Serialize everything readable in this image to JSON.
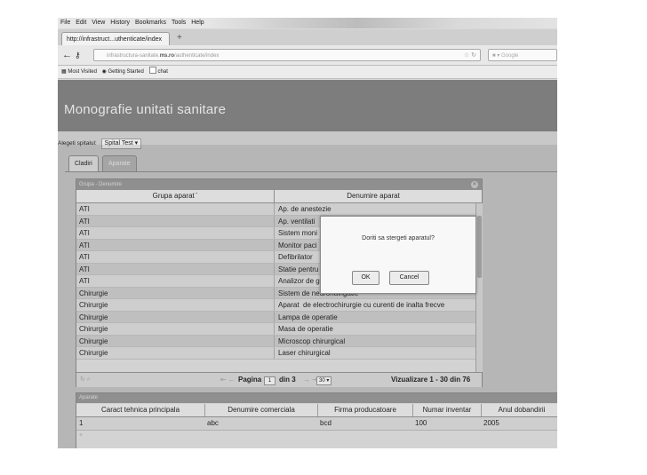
{
  "browser": {
    "menu": [
      "File",
      "Edit",
      "View",
      "History",
      "Bookmarks",
      "Tools",
      "Help"
    ],
    "tab_title": "http://infrastruct...uthenticate/index",
    "new_tab": "+",
    "url_prefix": "infrastructura-sanitate.",
    "url_domain": "ms.ro",
    "url_suffix": "/authenticate/index",
    "search_placeholder": "Google",
    "bookmarks": [
      "Most Visited",
      "Getting Started",
      "chat"
    ]
  },
  "app": {
    "title": "Monografie unitati sanitare",
    "hospital_label": "Alegeti spitalul:",
    "hospital_value": "Spital Test",
    "tabs": [
      "Cladiri",
      "Aparate"
    ]
  },
  "grid": {
    "caption": "Grupa - Denumire",
    "headers": [
      "Grupa aparat",
      "Denumire aparat"
    ],
    "rows": [
      {
        "grupa": "ATI",
        "denumire": "Ap. de anestezie"
      },
      {
        "grupa": "ATI",
        "denumire": "Ap. ventilati"
      },
      {
        "grupa": "ATI",
        "denumire": "Sistem moni"
      },
      {
        "grupa": "ATI",
        "denumire": "Monitor paci"
      },
      {
        "grupa": "ATI",
        "denumire": "Defibrilator"
      },
      {
        "grupa": "ATI",
        "denumire": "Statie pentru                                    dicamen"
      },
      {
        "grupa": "ATI",
        "denumire": "Analizor de g"
      },
      {
        "grupa": "Chirurgie",
        "denumire": "Sistem de neuronavigatie"
      },
      {
        "grupa": "Chirurgie",
        "denumire": "Aparat  de electrochirurgie cu curenti de inalta frecve"
      },
      {
        "grupa": "Chirurgie",
        "denumire": "Lampa de operatie"
      },
      {
        "grupa": "Chirurgie",
        "denumire": "Masa de operatie"
      },
      {
        "grupa": "Chirurgie",
        "denumire": "Microscop chirurgical"
      },
      {
        "grupa": "Chirurgie",
        "denumire": "Laser chirurgical"
      }
    ],
    "pager": {
      "page_label": "Pagina",
      "page_value": "1",
      "total": "din 3",
      "page_size": "30",
      "info": "Vizualizare 1 - 30 din 76"
    }
  },
  "grid2": {
    "caption": "Aparate",
    "headers": [
      "Caract tehnica principala",
      "Denumire comerciala",
      "Firma producatoare",
      "Numar inventar",
      "Anul dobandirii"
    ],
    "row": [
      "1",
      "abc",
      "bcd",
      "100",
      "2005"
    ]
  },
  "dialog": {
    "message": "Doriti sa stergeti aparatul?",
    "ok_label": "OK",
    "cancel_label": "Cancel"
  }
}
